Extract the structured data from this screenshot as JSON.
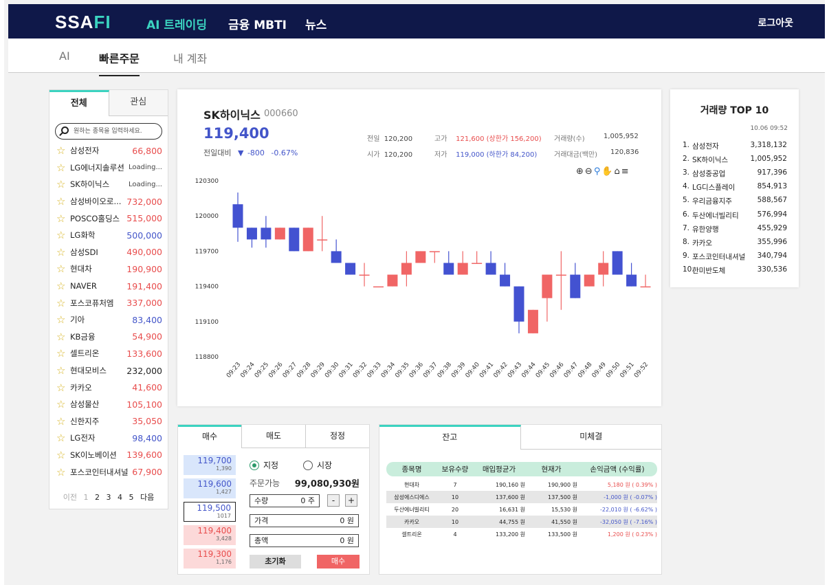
{
  "header": {
    "logo_main": "SSA",
    "logo_accent": "FI",
    "nav": [
      "AI 트레이딩",
      "금융 MBTI",
      "뉴스"
    ],
    "logout": "로그아웃"
  },
  "subnav": {
    "tabs": [
      "AI",
      "빠른주문",
      "내 계좌"
    ]
  },
  "watchlist": {
    "tabs": [
      "전체",
      "관심"
    ],
    "search_placeholder": "원하는 종목을 입력하세요.",
    "items": [
      {
        "name": "삼성전자",
        "price": "66,800",
        "trend": "up"
      },
      {
        "name": "LG에너지솔루션",
        "price": "Loading...",
        "trend": "load"
      },
      {
        "name": "SK하이닉스",
        "price": "Loading...",
        "trend": "load"
      },
      {
        "name": "삼성바이오로...",
        "price": "732,000",
        "trend": "up"
      },
      {
        "name": "POSCO홀딩스",
        "price": "515,000",
        "trend": "up"
      },
      {
        "name": "LG화학",
        "price": "500,000",
        "trend": "down"
      },
      {
        "name": "삼성SDI",
        "price": "490,000",
        "trend": "up"
      },
      {
        "name": "현대차",
        "price": "190,900",
        "trend": "up"
      },
      {
        "name": "NAVER",
        "price": "191,400",
        "trend": "up"
      },
      {
        "name": "포스코퓨처엠",
        "price": "337,000",
        "trend": "up"
      },
      {
        "name": "기아",
        "price": "83,400",
        "trend": "down"
      },
      {
        "name": "KB금융",
        "price": "54,900",
        "trend": "up"
      },
      {
        "name": "셀트리온",
        "price": "133,600",
        "trend": "up"
      },
      {
        "name": "현대모비스",
        "price": "232,000",
        "trend": "flat"
      },
      {
        "name": "카카오",
        "price": "41,600",
        "trend": "up"
      },
      {
        "name": "삼성물산",
        "price": "105,100",
        "trend": "up"
      },
      {
        "name": "신한지주",
        "price": "35,050",
        "trend": "up"
      },
      {
        "name": "LG전자",
        "price": "98,400",
        "trend": "down"
      },
      {
        "name": "SK이노베이션",
        "price": "139,600",
        "trend": "up"
      },
      {
        "name": "포스코인터내셔널",
        "price": "67,900",
        "trend": "up"
      }
    ],
    "pager": {
      "prev": "이전",
      "pages": [
        "1",
        "2",
        "3",
        "4",
        "5"
      ],
      "next": "다음"
    }
  },
  "stock": {
    "name": "SK하이닉스",
    "code": "000660",
    "price": "119,400",
    "change_label": "전일대비",
    "change_arrow": "▼",
    "change": "-800",
    "change_pct": "-0.67%",
    "info": {
      "prev_label": "전일",
      "prev": "120,200",
      "open_label": "시가",
      "open": "120,200",
      "high_label": "고가",
      "high": "121,600 (상한가 156,200)",
      "low_label": "저가",
      "low": "119,000 (하한가 84,200)",
      "vol_label": "거래량(수)",
      "vol": "1,005,952",
      "amt_label": "거래대금(백만)",
      "amt": "120,836"
    }
  },
  "chart_data": {
    "type": "candlestick",
    "x": [
      "09:23",
      "09:24",
      "09:25",
      "09:26",
      "09:27",
      "09:28",
      "09:29",
      "09:30",
      "09:31",
      "09:32",
      "09:33",
      "09:34",
      "09:35",
      "09:36",
      "09:37",
      "09:38",
      "09:39",
      "09:40",
      "09:41",
      "09:42",
      "09:43",
      "09:44",
      "09:45",
      "09:46",
      "09:47",
      "09:48",
      "09:49",
      "09:50",
      "09:51",
      "09:52"
    ],
    "ohlc": [
      [
        120100,
        120200,
        119780,
        119900
      ],
      [
        119900,
        119900,
        119730,
        119800
      ],
      [
        119900,
        120000,
        119730,
        119800
      ],
      [
        119800,
        119900,
        119800,
        119900
      ],
      [
        119900,
        119900,
        119700,
        119700
      ],
      [
        119700,
        119900,
        119700,
        119900
      ],
      [
        119800,
        120000,
        119700,
        119800
      ],
      [
        119700,
        119800,
        119600,
        119600
      ],
      [
        119600,
        119600,
        119500,
        119500
      ],
      [
        119500,
        119600,
        119400,
        119500
      ],
      [
        119400,
        119400,
        119400,
        119400
      ],
      [
        119400,
        119500,
        119400,
        119500
      ],
      [
        119500,
        119700,
        119400,
        119600
      ],
      [
        119600,
        119700,
        119600,
        119700
      ],
      [
        119700,
        119700,
        119600,
        119700
      ],
      [
        119600,
        119700,
        119500,
        119500
      ],
      [
        119500,
        119700,
        119500,
        119600
      ],
      [
        119600,
        119700,
        119600,
        119600
      ],
      [
        119600,
        119700,
        119500,
        119500
      ],
      [
        119500,
        119600,
        119400,
        119400
      ],
      [
        119400,
        119400,
        119000,
        119100
      ],
      [
        119000,
        119200,
        119000,
        119200
      ],
      [
        119300,
        119500,
        119100,
        119500
      ],
      [
        119500,
        119700,
        119200,
        119500
      ],
      [
        119500,
        119600,
        119300,
        119300
      ],
      [
        119400,
        119500,
        119400,
        119500
      ],
      [
        119500,
        119700,
        119400,
        119600
      ],
      [
        119700,
        119700,
        119500,
        119500
      ],
      [
        119500,
        119600,
        119400,
        119400
      ],
      [
        119400,
        119500,
        119400,
        119400
      ]
    ],
    "y_ticks": [
      "120300",
      "120000",
      "119700",
      "119400",
      "119100",
      "118800"
    ],
    "ylim": [
      118800,
      120300
    ],
    "colors": {
      "up": "#f06565",
      "down": "#4352d1"
    }
  },
  "chart_toolbar": {
    "icons": [
      "zoom-in-icon",
      "zoom-out-icon",
      "zoom-select-icon",
      "pan-icon",
      "home-icon",
      "menu-icon"
    ]
  },
  "order": {
    "tabs": [
      "매수",
      "매도",
      "정정"
    ],
    "book": [
      {
        "price": "119,700",
        "qty": "1,390",
        "side": "buy"
      },
      {
        "price": "119,600",
        "qty": "1,427",
        "side": "buy"
      },
      {
        "price": "119,500",
        "qty": "1017",
        "side": "sel"
      },
      {
        "price": "119,400",
        "qty": "3,428",
        "side": "sell"
      },
      {
        "price": "119,300",
        "qty": "1,176",
        "side": "sell"
      }
    ],
    "type_limit": "지정",
    "type_market": "시장",
    "available_label": "주문가능",
    "available": "99,080,930원",
    "qty_label": "수량",
    "qty_value": "0 주",
    "minus": "-",
    "plus": "+",
    "price_label": "가격",
    "price_value": "0 원",
    "total_label": "총액",
    "total_value": "0 원",
    "reset": "초기화",
    "buy": "매수"
  },
  "holdings": {
    "tabs": [
      "잔고",
      "미체결"
    ],
    "columns": [
      "종목명",
      "보유수량",
      "매입평균가",
      "현재가",
      "손익금액 (수익률)"
    ],
    "rows": [
      {
        "name": "현대차",
        "qty": "7",
        "avg": "190,160 원",
        "cur": "190,900 원",
        "pl": "5,180 원 ( 0.39% )",
        "trend": "up"
      },
      {
        "name": "삼성에스디에스",
        "qty": "10",
        "avg": "137,600 원",
        "cur": "137,500 원",
        "pl": "-1,000 원 ( -0.07% )",
        "trend": "down"
      },
      {
        "name": "두산에너빌리티",
        "qty": "20",
        "avg": "16,631 원",
        "cur": "15,530 원",
        "pl": "-22,010 원 ( -6.62% )",
        "trend": "down"
      },
      {
        "name": "카카오",
        "qty": "10",
        "avg": "44,755 원",
        "cur": "41,550 원",
        "pl": "-32,050 원 ( -7.16% )",
        "trend": "down"
      },
      {
        "name": "셀트리온",
        "qty": "4",
        "avg": "133,200 원",
        "cur": "133,500 원",
        "pl": "1,200 원 ( 0.23% )",
        "trend": "up"
      }
    ]
  },
  "top10": {
    "title": "거래량 TOP 10",
    "time": "10.06 09:52",
    "items": [
      {
        "rank": "1.",
        "name": "삼성전자",
        "vol": "3,318,132"
      },
      {
        "rank": "2.",
        "name": "SK하이닉스",
        "vol": "1,005,952"
      },
      {
        "rank": "3.",
        "name": "삼성중공업",
        "vol": "917,396"
      },
      {
        "rank": "4.",
        "name": "LG디스플레이",
        "vol": "854,913"
      },
      {
        "rank": "5.",
        "name": "우리금융지주",
        "vol": "588,567"
      },
      {
        "rank": "6.",
        "name": "두산에너빌리티",
        "vol": "576,994"
      },
      {
        "rank": "7.",
        "name": "유한양행",
        "vol": "455,929"
      },
      {
        "rank": "8.",
        "name": "카카오",
        "vol": "355,996"
      },
      {
        "rank": "9.",
        "name": "포스코인터내셔널",
        "vol": "340,794"
      },
      {
        "rank": "10.",
        "name": "한미반도체",
        "vol": "330,536"
      }
    ]
  }
}
